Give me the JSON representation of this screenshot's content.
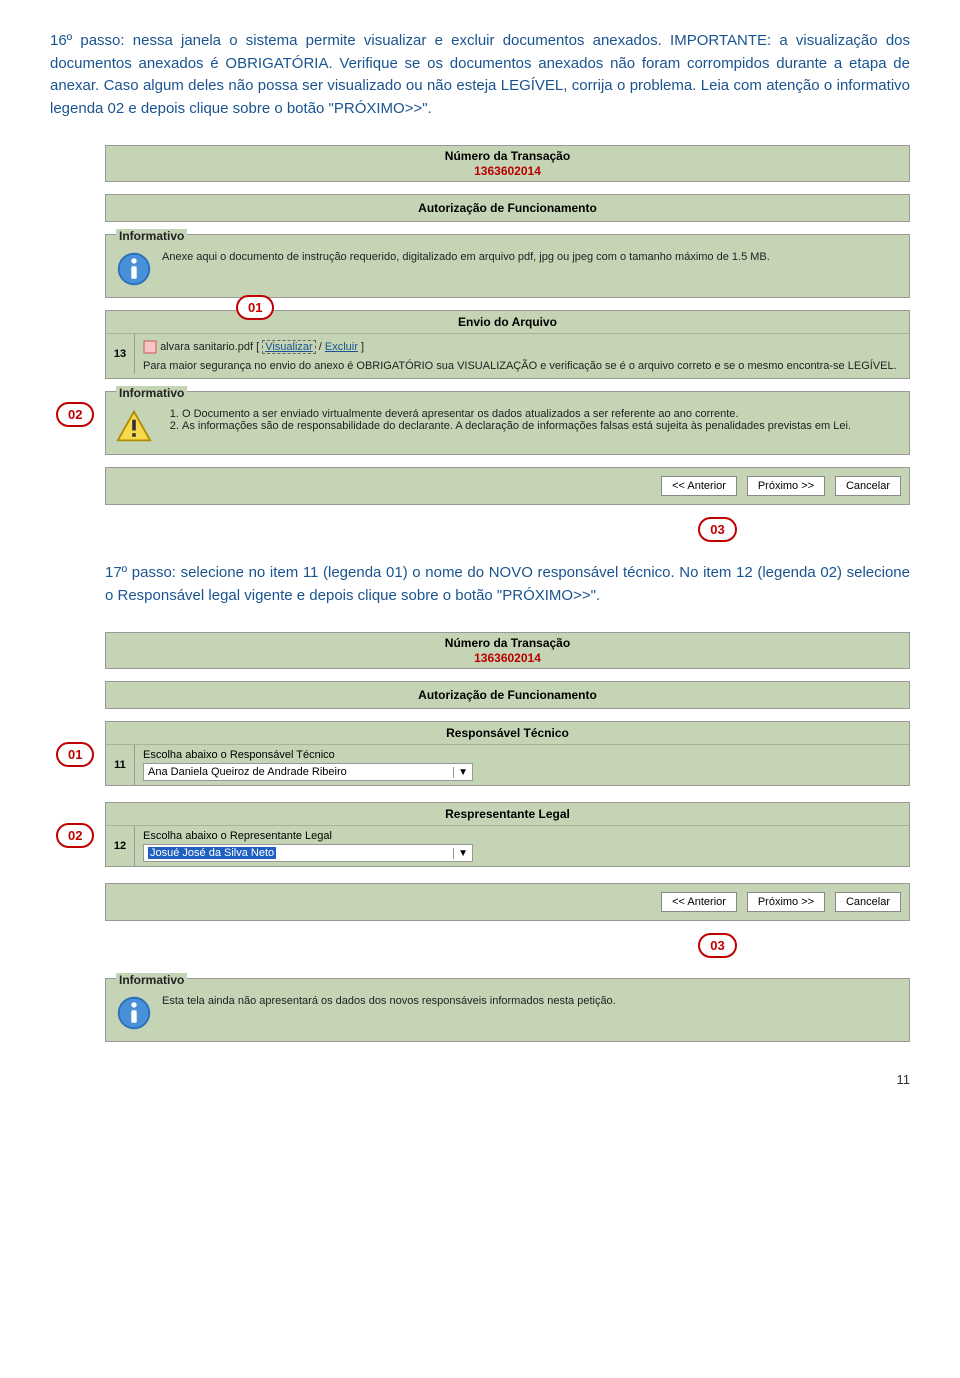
{
  "step16": {
    "text": "16º passo: nessa janela o sistema permite visualizar e excluir documentos anexados. IMPORTANTE: a visualização dos documentos anexados é OBRIGATÓRIA. Verifique se os documentos anexados não foram corrompidos durante a etapa de anexar. Caso algum deles não possa ser visualizado ou não esteja LEGÍVEL, corrija o problema. Leia com atenção o informativo legenda 02 e depois clique sobre o botão \"PRÓXIMO>>\"."
  },
  "transaction": {
    "label": "Número da Transação",
    "value": "1363602014"
  },
  "authTitle": "Autorização de Funcionamento",
  "informativo1": {
    "label": "Informativo",
    "text": "Anexe aqui o documento de instrução requerido, digitalizado em arquivo pdf, jpg ou jpeg com o tamanho máximo de 1.5 MB."
  },
  "envio": {
    "title": "Envio do Arquivo",
    "num": "13",
    "filename": "alvara sanitario.pdf",
    "bracket_open": "[",
    "visualizar": "Visualizar",
    "sep": "/",
    "excluir": "Excluir",
    "bracket_close": "]",
    "note": "Para maior segurança no envio do anexo é OBRIGATÓRIO sua VISUALIZAÇÃO e verificação se é o arquivo correto e se o mesmo encontra-se LEGÍVEL."
  },
  "informativo2": {
    "label": "Informativo",
    "item1": "O Documento a ser enviado virtualmente deverá apresentar os dados atualizados a ser referente ao ano corrente.",
    "item2": "As informações são de responsabilidade do declarante. A declaração de informações falsas está sujeita às penalidades previstas em Lei."
  },
  "buttons": {
    "anterior": "<< Anterior",
    "proximo": "Próximo >>",
    "cancelar": "Cancelar"
  },
  "callouts": {
    "c01": "01",
    "c02": "02",
    "c03": "03"
  },
  "step17": {
    "text": "17º passo: selecione no item 11 (legenda 01) o nome do NOVO responsável técnico. No item 12 (legenda 02) selecione o Responsável legal vigente e depois clique sobre o botão \"PRÓXIMO>>\"."
  },
  "respTecnico": {
    "title": "Responsável Técnico",
    "num": "11",
    "label": "Escolha abaixo o Responsável Técnico",
    "value": "Ana Daniela Queiroz de Andrade Ribeiro"
  },
  "respLegal": {
    "title": "Respresentante Legal",
    "num": "12",
    "label": "Escolha abaixo o Representante Legal",
    "value": "Josué José da Silva Neto"
  },
  "informativo3": {
    "label": "Informativo",
    "text": "Esta tela ainda não apresentará os dados dos novos responsáveis informados nesta petição."
  },
  "pageNum": "11"
}
